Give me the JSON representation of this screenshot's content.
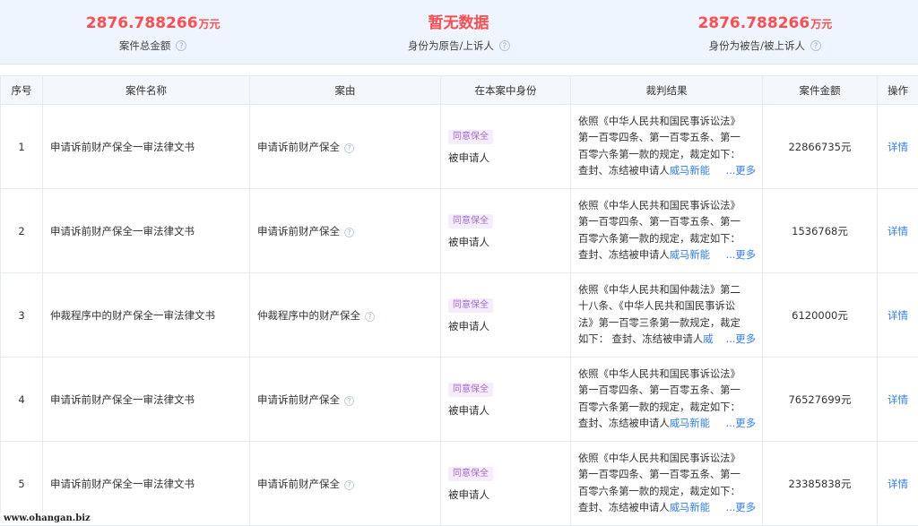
{
  "summary": [
    {
      "value": "2876.788266",
      "unit": "万元",
      "label": "案件总金额"
    },
    {
      "value": "暂无数据",
      "unit": "",
      "label": "身份为原告/上诉人"
    },
    {
      "value": "2876.788266",
      "unit": "万元",
      "label": "身份为被告/被上诉人"
    }
  ],
  "table": {
    "headers": [
      "序号",
      "案件名称",
      "案由",
      "在本案中身份",
      "裁判结果",
      "案件金额",
      "操作"
    ],
    "rows": [
      {
        "index": "1",
        "name": "申请诉前财产保全一审法律文书",
        "cause": "申请诉前财产保全",
        "badge": "同意保全",
        "role": "被申请人",
        "ruling_lines": [
          "依照《中华人民共和国民事诉讼法》",
          "第一百零四条、第一百零五条、第一",
          "百零六条第一款的规定，裁定如下："
        ],
        "ruling_last": "查封、冻结被申请人",
        "ruling_company": "威马新能",
        "more": "...更多",
        "amount": "22866735元",
        "action": "详情"
      },
      {
        "index": "2",
        "name": "申请诉前财产保全一审法律文书",
        "cause": "申请诉前财产保全",
        "badge": "同意保全",
        "role": "被申请人",
        "ruling_lines": [
          "依照《中华人民共和国民事诉讼法》",
          "第一百零四条、第一百零五条、第一",
          "百零六条第一款的规定，裁定如下："
        ],
        "ruling_last": "查封、冻结被申请人",
        "ruling_company": "威马新能",
        "more": "...更多",
        "amount": "1536768元",
        "action": "详情"
      },
      {
        "index": "3",
        "name": "仲裁程序中的财产保全一审法律文书",
        "cause": "仲裁程序中的财产保全",
        "badge": "同意保全",
        "role": "被申请人",
        "ruling_lines": [
          "依照《中华人民共和国仲裁法》第二",
          "十八条、《中华人民共和国民事诉讼",
          "法》第一百零三条第一款规定，裁定"
        ],
        "ruling_last": "如下： 查封、冻结被申请人",
        "ruling_company": "威",
        "more": "...更多",
        "amount": "6120000元",
        "action": "详情"
      },
      {
        "index": "4",
        "name": "申请诉前财产保全一审法律文书",
        "cause": "申请诉前财产保全",
        "badge": "同意保全",
        "role": "被申请人",
        "ruling_lines": [
          "依照《中华人民共和国民事诉讼法》",
          "第一百零四条、第一百零五条、第一",
          "百零六条第一款的规定，裁定如下："
        ],
        "ruling_last": "查封、冻结被申请人",
        "ruling_company": "威马新能",
        "more": "...更多",
        "amount": "76527699元",
        "action": "详情"
      },
      {
        "index": "5",
        "name": "申请诉前财产保全一审法律文书",
        "cause": "申请诉前财产保全",
        "badge": "同意保全",
        "role": "被申请人",
        "ruling_lines": [
          "依照《中华人民共和国民事诉讼法》",
          "第一百零四条、第一百零五条、第一",
          "百零六条第一款的规定，裁定如下："
        ],
        "ruling_last": "查封、冻结被申请人",
        "ruling_company": "威马新能",
        "more": "...更多",
        "amount": "23385838元",
        "action": "详情"
      }
    ]
  },
  "watermark": "www.ohangan.biz",
  "colors": {
    "accent_red": "#ff4d4f",
    "link_blue": "#2f7ef0",
    "badge_purple": "#a26bd0",
    "header_bg": "#eef5ff"
  }
}
